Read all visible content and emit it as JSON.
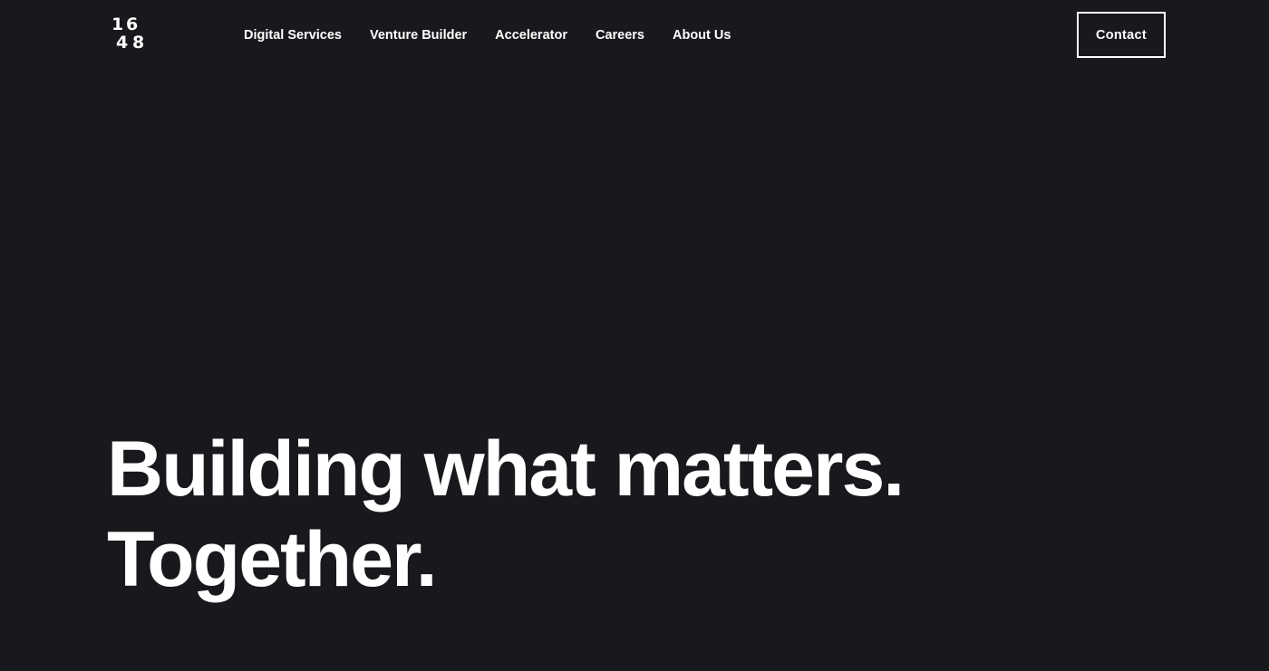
{
  "logo": {
    "digits": [
      "1",
      "6",
      "4",
      "8"
    ]
  },
  "nav": {
    "items": [
      {
        "label": "Digital Services"
      },
      {
        "label": "Venture Builder"
      },
      {
        "label": "Accelerator"
      },
      {
        "label": "Careers"
      },
      {
        "label": "About Us"
      }
    ]
  },
  "header": {
    "contact_label": "Contact"
  },
  "hero": {
    "line1": "Building what matters.",
    "line2": "Together."
  },
  "colors": {
    "background": "#18191d",
    "text": "#ffffff"
  }
}
